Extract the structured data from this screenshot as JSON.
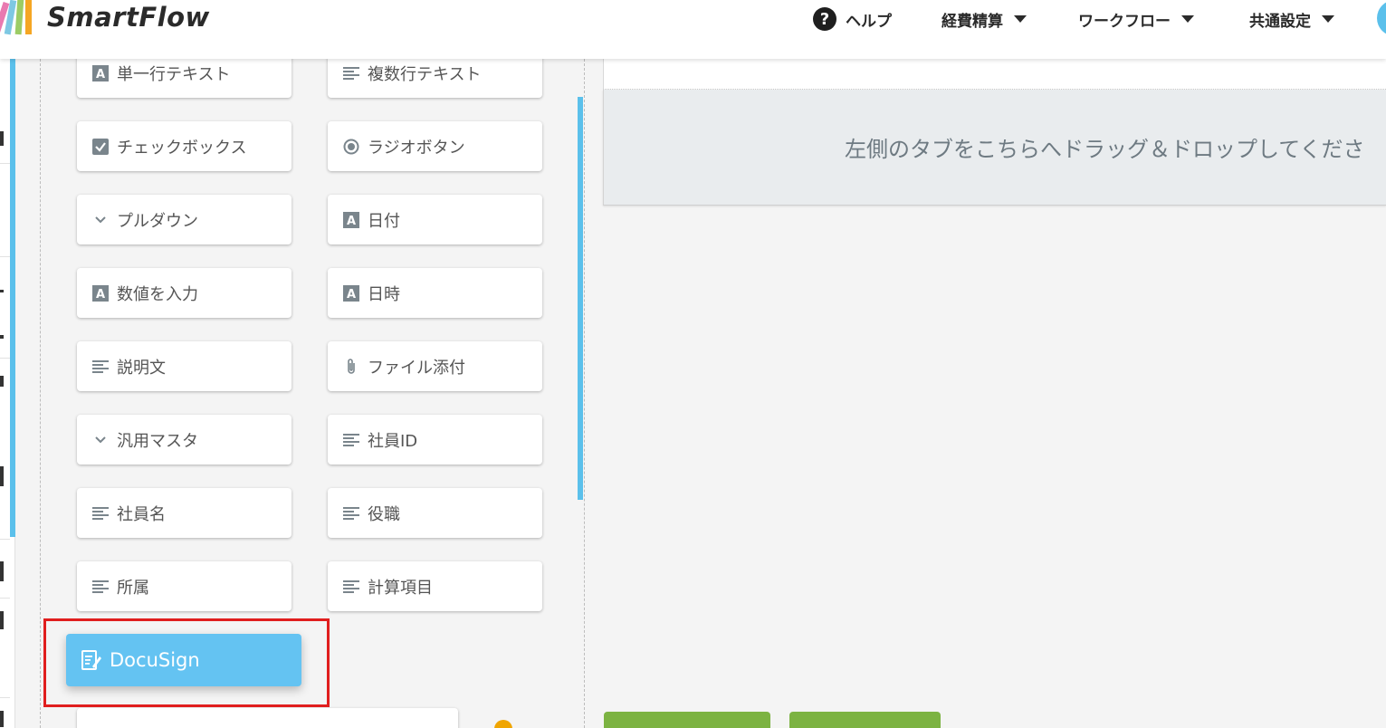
{
  "app": {
    "name": "SmartFlow",
    "brand_colors": {
      "accent": "#5bc0eb",
      "docusign": "#64c3f2",
      "highlight": "#e01e1e",
      "primary_action": "#7cb342"
    }
  },
  "header": {
    "help_label": "ヘルプ",
    "nav": [
      {
        "label": "経費精算",
        "icon": "caret-down-icon"
      },
      {
        "label": "ワークフロー",
        "icon": "caret-down-icon"
      },
      {
        "label": "共通設定",
        "icon": "caret-down-icon"
      }
    ]
  },
  "palette": {
    "fields": [
      {
        "label": "単一行テキスト",
        "icon": "text-a-icon"
      },
      {
        "label": "複数行テキスト",
        "icon": "lines-icon"
      },
      {
        "label": "チェックボックス",
        "icon": "checkbox-icon"
      },
      {
        "label": "ラジオボタン",
        "icon": "radio-icon"
      },
      {
        "label": "プルダウン",
        "icon": "chevron-down-icon"
      },
      {
        "label": "日付",
        "icon": "text-a-icon"
      },
      {
        "label": "数値を入力",
        "icon": "text-a-icon"
      },
      {
        "label": "日時",
        "icon": "text-a-icon"
      },
      {
        "label": "説明文",
        "icon": "lines-icon"
      },
      {
        "label": "ファイル添付",
        "icon": "paperclip-icon"
      },
      {
        "label": "汎用マスタ",
        "icon": "chevron-down-icon"
      },
      {
        "label": "社員ID",
        "icon": "lines-icon"
      },
      {
        "label": "社員名",
        "icon": "lines-icon"
      },
      {
        "label": "役職",
        "icon": "lines-icon"
      },
      {
        "label": "所属",
        "icon": "lines-icon"
      },
      {
        "label": "計算項目",
        "icon": "lines-icon"
      }
    ],
    "dragging": {
      "label": "DocuSign",
      "icon": "document-edit-icon"
    }
  },
  "canvas": {
    "drop_hint": "左側のタブをこちらへドラッグ＆ドロップしてくださ"
  }
}
